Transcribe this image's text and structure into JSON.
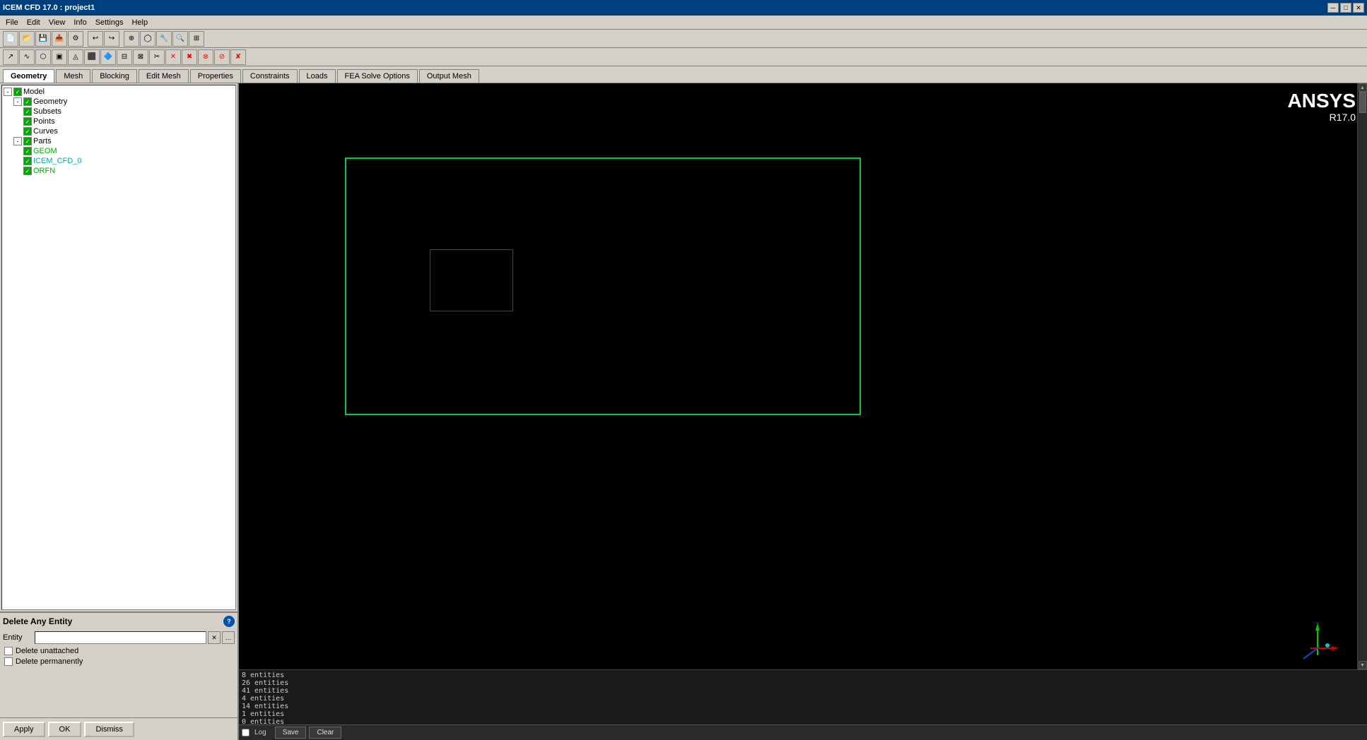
{
  "titlebar": {
    "title": "ICEM CFD 17.0 : project1",
    "min": "─",
    "max": "□",
    "close": "✕"
  },
  "menu": {
    "items": [
      "File",
      "Edit",
      "View",
      "Info",
      "Settings",
      "Help"
    ]
  },
  "toolbar1": {
    "buttons": [
      "📁",
      "💾",
      "📂",
      "🔧",
      "⚙",
      "🔄",
      "↩",
      "↪"
    ]
  },
  "tabs": {
    "items": [
      {
        "label": "Geometry",
        "active": true
      },
      {
        "label": "Mesh",
        "active": false
      },
      {
        "label": "Blocking",
        "active": false
      },
      {
        "label": "Edit Mesh",
        "active": false
      },
      {
        "label": "Properties",
        "active": false
      },
      {
        "label": "Constraints",
        "active": false
      },
      {
        "label": "Loads",
        "active": false
      },
      {
        "label": "FEA Solve Options",
        "active": false
      },
      {
        "label": "Output Mesh",
        "active": false
      }
    ]
  },
  "tree": {
    "items": [
      {
        "label": "Model",
        "level": 0,
        "expand": "-",
        "checked": true
      },
      {
        "label": "Geometry",
        "level": 1,
        "expand": "-",
        "checked": true
      },
      {
        "label": "Subsets",
        "level": 2,
        "expand": null,
        "checked": true
      },
      {
        "label": "Points",
        "level": 2,
        "expand": null,
        "checked": true
      },
      {
        "label": "Curves",
        "level": 2,
        "expand": null,
        "checked": true
      },
      {
        "label": "Parts",
        "level": 1,
        "expand": "-",
        "checked": true
      },
      {
        "label": "GEOM",
        "level": 2,
        "expand": null,
        "checked": true,
        "color": "green"
      },
      {
        "label": "ICEM_CFD_0",
        "level": 2,
        "expand": null,
        "checked": true,
        "color": "cyan"
      },
      {
        "label": "ORFN",
        "level": 2,
        "expand": null,
        "checked": true,
        "color": "green"
      }
    ]
  },
  "delete_panel": {
    "title": "Delete Any Entity",
    "entity_label": "Entity",
    "entity_value": "",
    "delete_unattached_label": "Delete unattached",
    "delete_permanently_label": "Delete permanently",
    "help_icon": "?"
  },
  "bottom_buttons": {
    "apply": "Apply",
    "ok": "OK",
    "dismiss": "Dismiss"
  },
  "ansys": {
    "logo": "ANSYS",
    "version": "R17.0"
  },
  "log": {
    "lines": [
      "8 entities",
      "26 entities",
      "41 entities",
      "4 entities",
      "14 entities",
      "1 entities",
      "0 entities"
    ],
    "log_label": "Log",
    "save_label": "Save",
    "clear_label": "Clear"
  },
  "icons": {
    "toolbar_geo": [
      "⬡",
      "∿",
      "□",
      "◯",
      "⊕",
      "⟳",
      "✂",
      "⊗",
      "⊘",
      "🔺",
      "🔷",
      "⬛",
      "▲",
      "✖",
      "✕",
      "✘",
      "⊠"
    ]
  }
}
